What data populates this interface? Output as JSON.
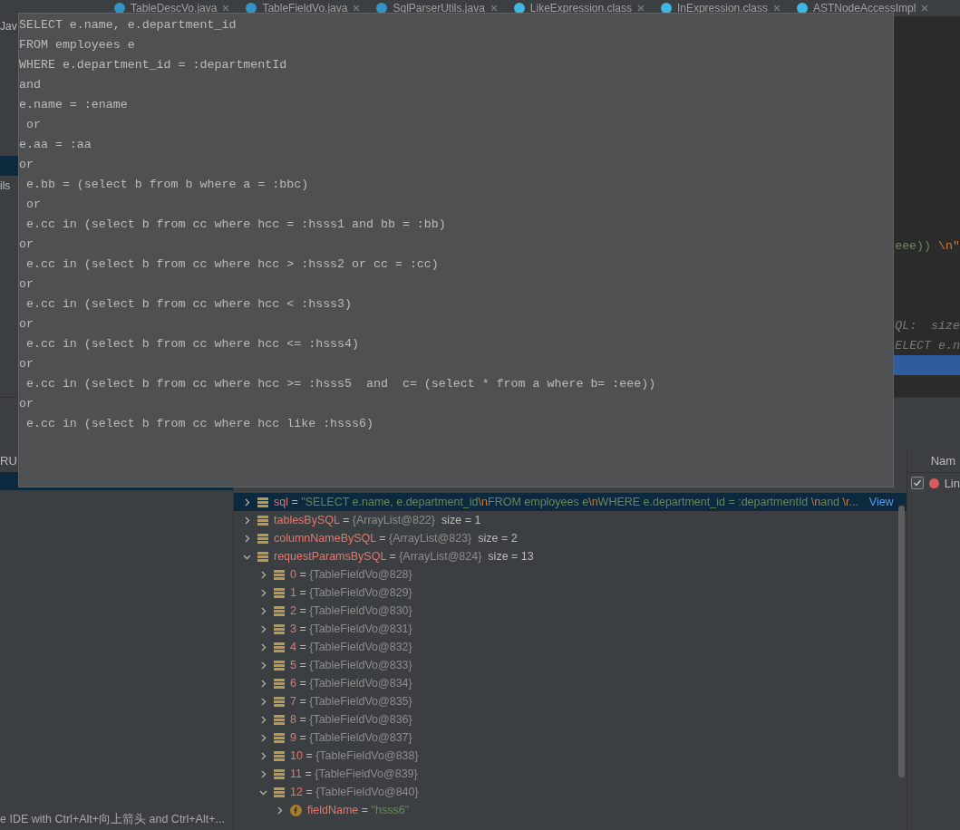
{
  "tabs": [
    {
      "label": "TableDescVo.java",
      "kind": "java"
    },
    {
      "label": "TableFieldVo.java",
      "kind": "java"
    },
    {
      "label": "SqlParserUtils.java",
      "kind": "java"
    },
    {
      "label": "LikeExpression.class",
      "kind": "class"
    },
    {
      "label": "InExpression.class",
      "kind": "class"
    },
    {
      "label": "ASTNodeAccessImpl",
      "kind": "class"
    }
  ],
  "editor_rows": [
    {
      "tree": {
        "label": "Jav",
        "selected": false
      },
      "execution_point": false
    },
    {
      "execution_point": false
    },
    {
      "execution_point": false
    },
    {
      "execution_point": false
    },
    {
      "execution_point": false
    },
    {
      "execution_point": false
    },
    {
      "execution_point": false
    },
    {
      "tree": {
        "selected": true
      },
      "execution_point": false
    },
    {
      "tree": {
        "label": "ils",
        "selected": false
      },
      "execution_point": false
    },
    {
      "execution_point": false
    },
    {
      "execution_point": false
    },
    {
      "code": [
        {
          "text": "eee)) ",
          "kind": "string"
        },
        {
          "text": "\\n\"",
          "kind": "escape"
        }
      ],
      "execution_point": false
    },
    {
      "execution_point": false
    },
    {
      "execution_point": false
    },
    {
      "execution_point": false
    },
    {
      "code": [
        {
          "text": "QL:  size",
          "kind": "inlay"
        }
      ],
      "execution_point": false
    },
    {
      "code": [
        {
          "text": "ELECT e.n",
          "kind": "inlay"
        }
      ],
      "execution_point": false
    },
    {
      "execution_point": true
    }
  ],
  "popup_lines": [
    "SELECT e.name, e.department_id",
    "FROM employees e",
    "WHERE e.department_id = :departmentId",
    "and",
    "e.name = :ename",
    " or",
    "e.aa = :aa",
    "or",
    " e.bb = (select b from b where a = :bbc)",
    " or",
    " e.cc in (select b from cc where hcc = :hsss1 and bb = :bb)",
    "or",
    " e.cc in (select b from cc where hcc > :hsss2 or cc = :cc)",
    "or",
    " e.cc in (select b from cc where hcc < :hsss3)",
    "or",
    " e.cc in (select b from cc where hcc <= :hsss4)",
    "or",
    " e.cc in (select b from cc where hcc >= :hsss5  and  c= (select * from a where b= :eee))",
    "or",
    " e.cc in (select b from cc where hcc like :hsss6)"
  ],
  "frames": {
    "header": "RU",
    "rows": [
      {
        "selected": true
      }
    ]
  },
  "notification": {
    "text": "e IDE with Ctrl+Alt+向上箭头 and Ctrl+Alt+..."
  },
  "breakpoints": {
    "header": "Nam",
    "rows": [
      {
        "label": "Lin",
        "checked": true,
        "color": "#db5c5c"
      }
    ]
  },
  "variables": [
    {
      "name": "sql",
      "eq": "=",
      "kind": "object",
      "expanded": false,
      "selected": true,
      "value": [
        {
          "text": "\"SELECT e.name, e.department_id",
          "kind": "string"
        },
        {
          "text": "\\n",
          "kind": "escape"
        },
        {
          "text": "FROM employees e",
          "kind": "string"
        },
        {
          "text": "\\n",
          "kind": "escape"
        },
        {
          "text": "WHERE e.department_id = :departmentId ",
          "kind": "string"
        },
        {
          "text": "\\n",
          "kind": "escape"
        },
        {
          "text": "and ",
          "kind": "string"
        },
        {
          "text": "\\r",
          "kind": "escape"
        },
        {
          "text": "...",
          "kind": "string"
        }
      ],
      "link": "View"
    },
    {
      "name": "tablesBySQL",
      "eq": "=",
      "kind": "object",
      "expanded": false,
      "selected": false,
      "value": [
        {
          "text": "{ArrayList@822}",
          "kind": "ref"
        },
        {
          "text": "  size = 1",
          "kind": "plain"
        }
      ]
    },
    {
      "name": "columnNameBySQL",
      "eq": "=",
      "kind": "object",
      "expanded": false,
      "selected": false,
      "value": [
        {
          "text": "{ArrayList@823}",
          "kind": "ref"
        },
        {
          "text": "  size = 2",
          "kind": "plain"
        }
      ]
    },
    {
      "name": "requestParamsBySQL",
      "eq": "=",
      "kind": "object",
      "expanded": true,
      "selected": false,
      "value": [
        {
          "text": "{ArrayList@824}",
          "kind": "ref"
        },
        {
          "text": "  size = 13",
          "kind": "plain"
        }
      ],
      "children": [
        {
          "name": "0",
          "eq": "=",
          "kind": "object",
          "expanded": false,
          "selected": false,
          "value": [
            {
              "text": "{TableFieldVo@828}",
              "kind": "ref"
            }
          ]
        },
        {
          "name": "1",
          "eq": "=",
          "kind": "object",
          "expanded": false,
          "selected": false,
          "value": [
            {
              "text": "{TableFieldVo@829}",
              "kind": "ref"
            }
          ]
        },
        {
          "name": "2",
          "eq": "=",
          "kind": "object",
          "expanded": false,
          "selected": false,
          "value": [
            {
              "text": "{TableFieldVo@830}",
              "kind": "ref"
            }
          ]
        },
        {
          "name": "3",
          "eq": "=",
          "kind": "object",
          "expanded": false,
          "selected": false,
          "value": [
            {
              "text": "{TableFieldVo@831}",
              "kind": "ref"
            }
          ]
        },
        {
          "name": "4",
          "eq": "=",
          "kind": "object",
          "expanded": false,
          "selected": false,
          "value": [
            {
              "text": "{TableFieldVo@832}",
              "kind": "ref"
            }
          ]
        },
        {
          "name": "5",
          "eq": "=",
          "kind": "object",
          "expanded": false,
          "selected": false,
          "value": [
            {
              "text": "{TableFieldVo@833}",
              "kind": "ref"
            }
          ]
        },
        {
          "name": "6",
          "eq": "=",
          "kind": "object",
          "expanded": false,
          "selected": false,
          "value": [
            {
              "text": "{TableFieldVo@834}",
              "kind": "ref"
            }
          ]
        },
        {
          "name": "7",
          "eq": "=",
          "kind": "object",
          "expanded": false,
          "selected": false,
          "value": [
            {
              "text": "{TableFieldVo@835}",
              "kind": "ref"
            }
          ]
        },
        {
          "name": "8",
          "eq": "=",
          "kind": "object",
          "expanded": false,
          "selected": false,
          "value": [
            {
              "text": "{TableFieldVo@836}",
              "kind": "ref"
            }
          ]
        },
        {
          "name": "9",
          "eq": "=",
          "kind": "object",
          "expanded": false,
          "selected": false,
          "value": [
            {
              "text": "{TableFieldVo@837}",
              "kind": "ref"
            }
          ]
        },
        {
          "name": "10",
          "eq": "=",
          "kind": "object",
          "expanded": false,
          "selected": false,
          "value": [
            {
              "text": "{TableFieldVo@838}",
              "kind": "ref"
            }
          ]
        },
        {
          "name": "11",
          "eq": "=",
          "kind": "object",
          "expanded": false,
          "selected": false,
          "value": [
            {
              "text": "{TableFieldVo@839}",
              "kind": "ref"
            }
          ]
        },
        {
          "name": "12",
          "eq": "=",
          "kind": "object",
          "expanded": true,
          "selected": false,
          "value": [
            {
              "text": "{TableFieldVo@840}",
              "kind": "ref"
            }
          ],
          "children": [
            {
              "name": "fieldName",
              "eq": "=",
              "kind": "field",
              "expanded": false,
              "selected": false,
              "value": [
                {
                  "text": "\"hsss6\"",
                  "kind": "string"
                }
              ]
            }
          ]
        }
      ]
    }
  ]
}
